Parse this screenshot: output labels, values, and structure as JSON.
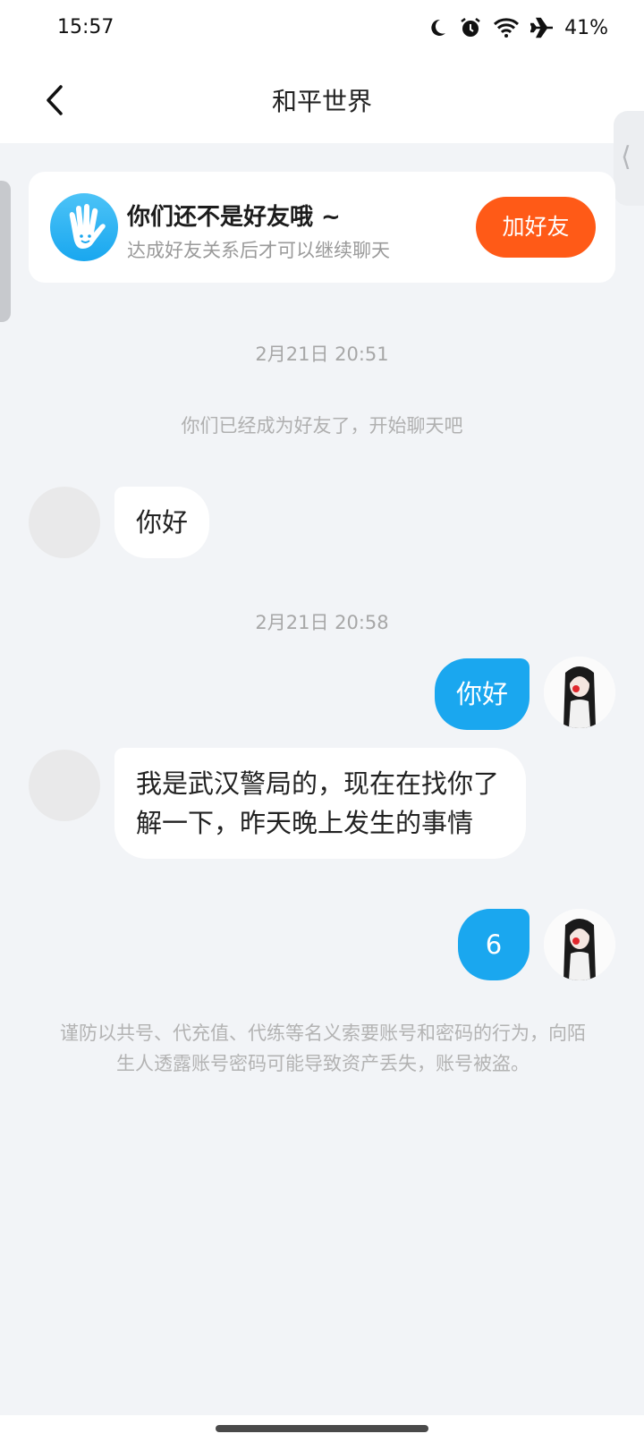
{
  "status_bar": {
    "time": "15:57",
    "battery": "41%",
    "icons": [
      "moon-icon",
      "alarm-icon",
      "wifi-icon",
      "airplane-icon"
    ]
  },
  "header": {
    "title": "和平世界",
    "back_icon": "chevron-left-icon"
  },
  "friend_notice": {
    "icon": "wave-hand-icon",
    "title": "你们还不是好友哦 ~",
    "subtitle": "达成好友关系后才可以继续聊天",
    "button_label": "加好友",
    "button_color": "#ff5a17"
  },
  "chat": {
    "timestamp_1": "2月21日 20:51",
    "system_message": "你们已经成为好友了，开始聊天吧",
    "msg_1": "你好",
    "timestamp_2": "2月21日 20:58",
    "msg_2": "你好",
    "msg_3": "我是武汉警局的，现在在找你了解一下，昨天晚上发生的事情",
    "msg_4": "6",
    "self_bubble_color": "#1aa7ef"
  },
  "warning": "谨防以共号、代充值、代练等名义索要账号和密码的行为，向陌生人透露账号密码可能导致资产丢失，账号被盗。"
}
